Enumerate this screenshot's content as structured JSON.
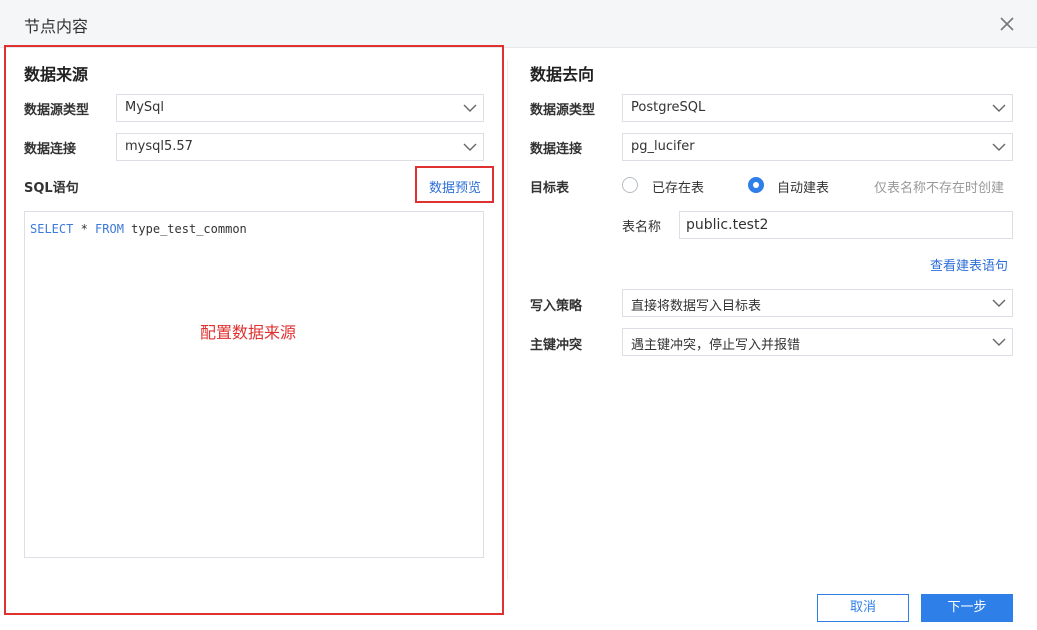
{
  "dialog": {
    "title": "节点内容"
  },
  "source": {
    "section_title": "数据来源",
    "type_label": "数据源类型",
    "type_value": "MySql",
    "conn_label": "数据连接",
    "conn_value": "mysql5.57",
    "sql_label": "SQL语句",
    "preview_link": "数据预览",
    "sql_keyword_select": "SELECT",
    "sql_star": " * ",
    "sql_keyword_from": "FROM",
    "sql_table": " type_test_common",
    "annotation": "配置数据来源"
  },
  "target": {
    "section_title": "数据去向",
    "type_label": "数据源类型",
    "type_value": "PostgreSQL",
    "conn_label": "数据连接",
    "conn_value": "pg_lucifer",
    "table_label": "目标表",
    "radio_existing": "已存在表",
    "radio_auto": "自动建表",
    "hint": "仅表名称不存在时创建",
    "table_name_label": "表名称",
    "table_name_value": "public.test2",
    "view_ddl_link": "查看建表语句",
    "write_label": "写入策略",
    "write_value": "直接将数据写入目标表",
    "conflict_label": "主键冲突",
    "conflict_value": "遇主键冲突，停止写入并报错"
  },
  "footer": {
    "cancel_label": "取消",
    "next_label": "下一步"
  },
  "colors": {
    "accent": "#2f7fe8",
    "annotation_red": "#e03131"
  }
}
